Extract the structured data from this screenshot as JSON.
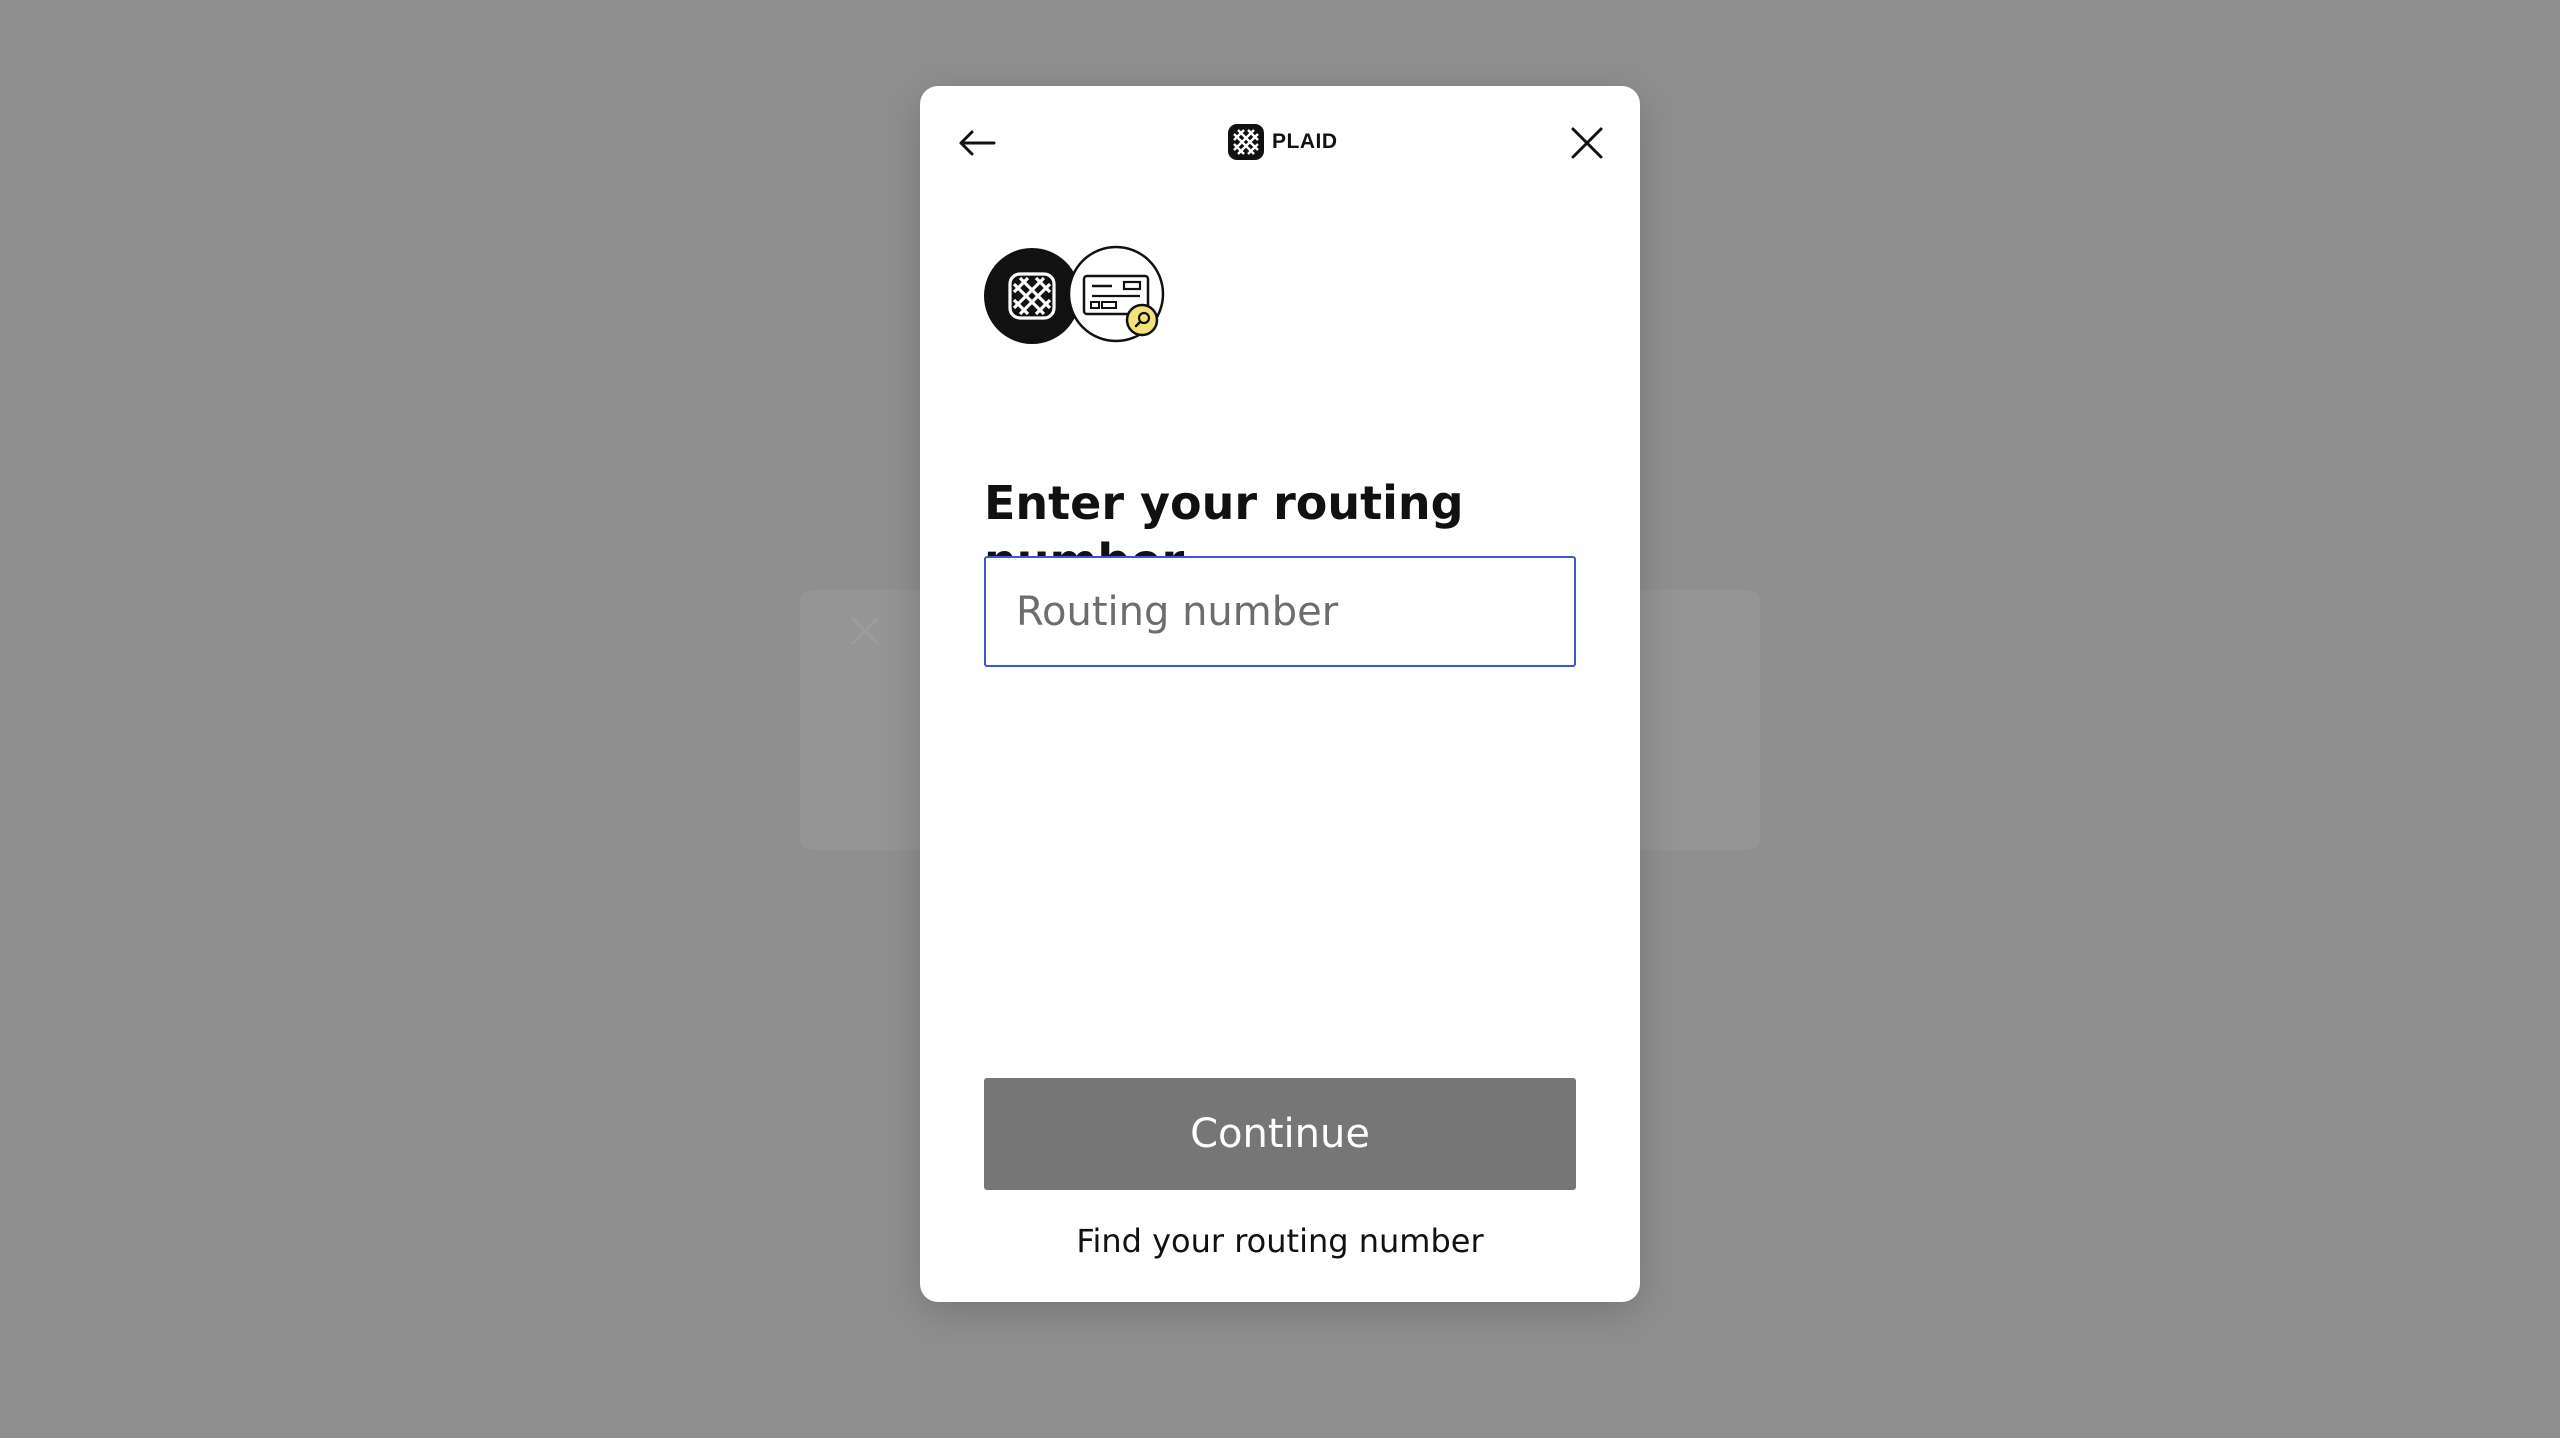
{
  "modal": {
    "brand": {
      "name": "PLAID",
      "logo_icon": "plaid-logo-icon"
    },
    "header": {
      "back_icon": "arrow-left-icon",
      "close_icon": "close-icon"
    },
    "hero": {
      "icons": [
        "plaid-logo-icon",
        "check-search-icon"
      ]
    },
    "title": "Enter your routing number",
    "routing_input": {
      "placeholder": "Routing number",
      "value": ""
    },
    "continue_label": "Continue",
    "find_link_label": "Find your routing number"
  },
  "colors": {
    "overlay": "#8f8f8f",
    "input_focus_border": "#3d56d8",
    "button_disabled": "#767676",
    "search_badge": "#f2e27a"
  }
}
